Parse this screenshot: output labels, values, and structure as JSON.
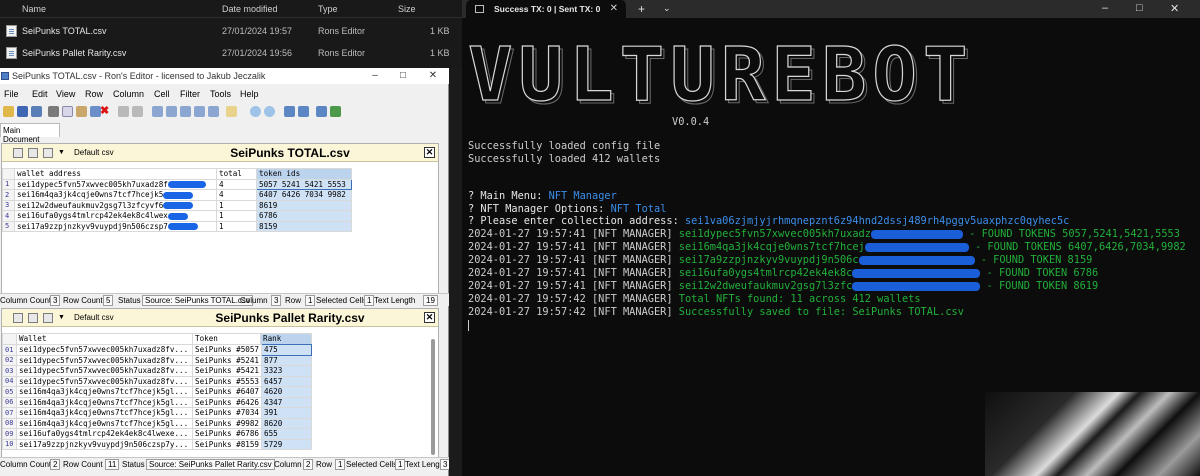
{
  "explorer": {
    "columns": [
      "Name",
      "Date modified",
      "Type",
      "Size"
    ],
    "rows": [
      {
        "name": "SeiPunks TOTAL.csv",
        "date": "27/01/2024 19:57",
        "type": "Rons Editor",
        "size": "1 KB"
      },
      {
        "name": "SeiPunks Pallet Rarity.csv",
        "date": "27/01/2024 19:56",
        "type": "Rons Editor",
        "size": "1 KB"
      }
    ]
  },
  "editor": {
    "title": "SeiPunks TOTAL.csv - Ron's Editor - licensed to Jakub Jeczalik",
    "menu": [
      "File",
      "Edit",
      "View",
      "Row",
      "Column",
      "Cell",
      "Filter",
      "Tools",
      "Help"
    ],
    "doc_tab": "Main Document",
    "panel1": {
      "format": "Default csv",
      "title": "SeiPunks TOTAL.csv",
      "headers": [
        "wallet address",
        "total",
        "token ids"
      ],
      "rows": [
        {
          "n": "1",
          "wallet": "sei1dypec5fvn57xwvec005kh7uxadz8f",
          "total": "4",
          "ids": "5057 5241 5421 5553"
        },
        {
          "n": "2",
          "wallet": "sei16m4qa3jk4cqje0wns7tcf7hcejk5",
          "total": "4",
          "ids": "6407 6426 7034 9982"
        },
        {
          "n": "3",
          "wallet": "sei12w2dweufaukmuv2gsg7l3zfcyvf6",
          "total": "1",
          "ids": "8619"
        },
        {
          "n": "4",
          "wallet": "sei16ufa0ygs4tmlrcp42ek4ek8c4lwex",
          "total": "1",
          "ids": "6786"
        },
        {
          "n": "5",
          "wallet": "sei17a9zzpjnzkyv9vuypdj9n506czsp7",
          "total": "1",
          "ids": "8159"
        }
      ],
      "status": {
        "col_count_label": "Column Count",
        "col_count": "3",
        "row_count_label": "Row Count",
        "row_count": "5",
        "status_label": "Status",
        "status_value": "Source: SeiPunks TOTAL.csv",
        "column_label": "Column",
        "column_value": "3",
        "row_label": "Row",
        "row_value": "1",
        "selected_label": "Selected Cells",
        "selected_value": "1",
        "text_len_label": "Text Length",
        "text_len_value": "19"
      }
    },
    "panel2": {
      "format": "Default csv",
      "title": "SeiPunks Pallet Rarity.csv",
      "headers": [
        "Wallet",
        "Token",
        "Rank"
      ],
      "rows": [
        {
          "n": "01",
          "wallet": "sei1dypec5fvn57xwvec005kh7uxadz8fv...",
          "token": "SeiPunks #5057",
          "rank": "475"
        },
        {
          "n": "02",
          "wallet": "sei1dypec5fvn57xwvec005kh7uxadz8fv...",
          "token": "SeiPunks #5241",
          "rank": "877"
        },
        {
          "n": "03",
          "wallet": "sei1dypec5fvn57xwvec005kh7uxadz8fv...",
          "token": "SeiPunks #5421",
          "rank": "3323"
        },
        {
          "n": "04",
          "wallet": "sei1dypec5fvn57xwvec005kh7uxadz8fv...",
          "token": "SeiPunks #5553",
          "rank": "6457"
        },
        {
          "n": "05",
          "wallet": "sei16m4qa3jk4cqje0wns7tcf7hcejk5gl...",
          "token": "SeiPunks #6407",
          "rank": "4620"
        },
        {
          "n": "06",
          "wallet": "sei16m4qa3jk4cqje0wns7tcf7hcejk5gl...",
          "token": "SeiPunks #6426",
          "rank": "4347"
        },
        {
          "n": "07",
          "wallet": "sei16m4qa3jk4cqje0wns7tcf7hcejk5gl...",
          "token": "SeiPunks #7034",
          "rank": "391"
        },
        {
          "n": "08",
          "wallet": "sei16m4qa3jk4cqje0wns7tcf7hcejk5gl...",
          "token": "SeiPunks #9982",
          "rank": "8620"
        },
        {
          "n": "09",
          "wallet": "sei16ufa0ygs4tmlrcp42ek4ek8c4lwexe...",
          "token": "SeiPunks #6786",
          "rank": "655"
        },
        {
          "n": "10",
          "wallet": "sei17a9zzpjnzkyv9vuypdj9n506czsp7y...",
          "token": "SeiPunks #8159",
          "rank": "5729"
        }
      ],
      "status": {
        "col_count_label": "Column Count",
        "col_count": "2",
        "row_count_label": "Row Count",
        "row_count": "11",
        "status_label": "Status",
        "status_value": "Source: SeiPunks Pallet Rarity.csv",
        "column_label": "Column",
        "column_value": "2",
        "row_label": "Row",
        "row_value": "1",
        "selected_label": "Selected Cells",
        "selected_value": "1",
        "text_len_label": "Text Length",
        "text_len_value": "3"
      }
    }
  },
  "terminal": {
    "tab_title": "Success TX: 0 | Sent TX: 0",
    "banner": "VULTUREBOT",
    "version": "V0.0.4",
    "lines": {
      "l1": "Successfully loaded config file",
      "l2": "Successfully loaded 412 wallets",
      "q1_label": "? Main Menu: ",
      "q1_value": "NFT Manager",
      "q2_label": "? NFT Manager Options: ",
      "q2_value": "NFT Total",
      "q3_label": "? Please enter collection address: ",
      "q3_value": "sei1va06zjmjyjrhmqnepznt6z94hnd2dssj489rh4pggv5uaxphzc0qyhec5c",
      "prefix_a": "2024-01-27 19:57:41 [NFT MANAGER] ",
      "prefix_b": "2024-01-27 19:57:42 [NFT MANAGER] ",
      "r1_wallet": "sei1dypec5fvn57xwvec005kh7uxadz",
      "r1_found": " - FOUND TOKENS 5057,5241,5421,5553",
      "r2_wallet": "sei16m4qa3jk4cqje0wns7tcf7hcej",
      "r2_found": " - FOUND TOKENS 6407,6426,7034,9982",
      "r3_wallet": "sei17a9zzpjnzkyv9vuypdj9n506c",
      "r3_found": " - FOUND TOKEN 8159",
      "r4_wallet": "sei16ufa0ygs4tmlrcp42ek4ek8c",
      "r4_found": " - FOUND TOKEN 6786",
      "r5_wallet": "sei12w2dweufaukmuv2gsg7l3zfc",
      "r5_found": " - FOUND TOKEN 8619",
      "total": "Total NFTs found: 11 across 412 wallets",
      "saved": "Successfully saved to file: SeiPunks TOTAL.csv"
    }
  }
}
